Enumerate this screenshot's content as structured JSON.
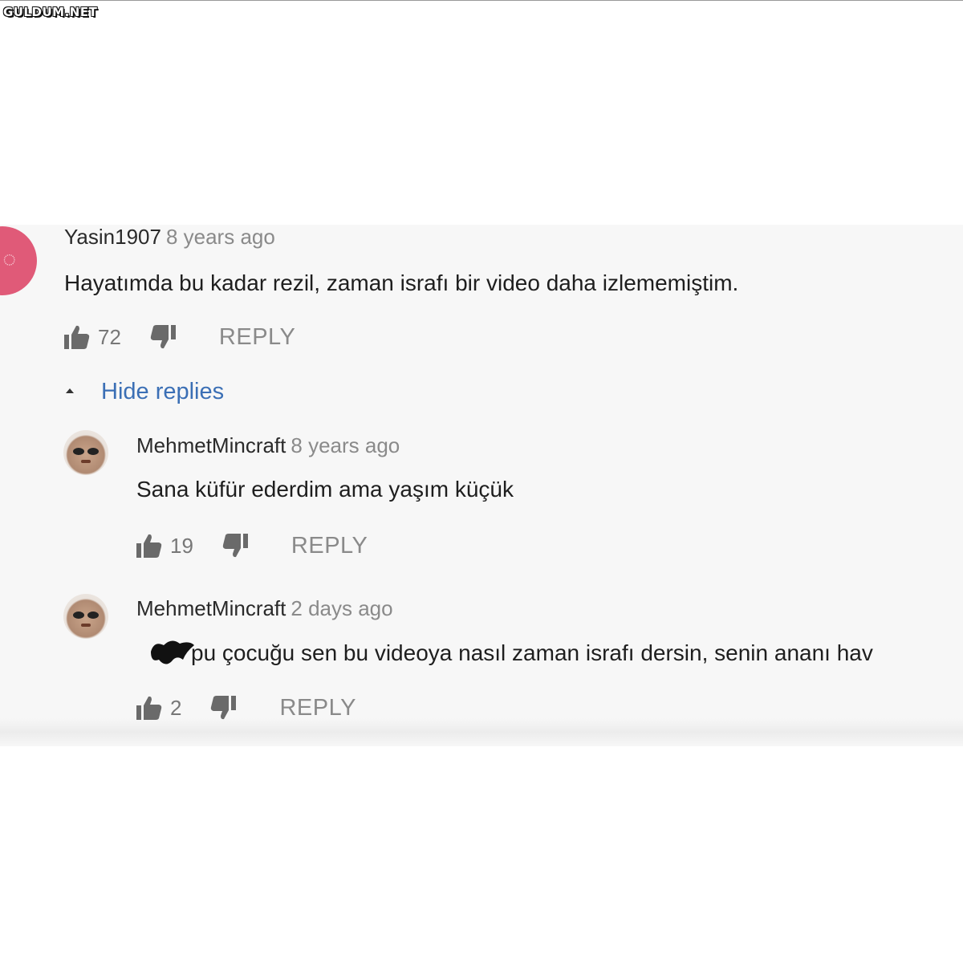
{
  "watermark": "GULDUM.NET",
  "comments": [
    {
      "author": "Yasin1907",
      "time": "8 years ago",
      "text": "Hayatımda bu kadar rezil, zaman israfı bir video daha izlememiştim.",
      "likes": "72",
      "reply_label": "REPLY",
      "avatar_icon": "default-letter-avatar",
      "avatar_color": "#e05a78"
    }
  ],
  "hide_replies_label": "Hide replies",
  "replies": [
    {
      "author": "MehmetMincraft",
      "time": "8 years ago",
      "text": "Sana küfür ederdim ama yaşım küçük",
      "likes": "19",
      "reply_label": "REPLY",
      "avatar_icon": "face-avatar"
    },
    {
      "author": "MehmetMincraft",
      "time": "2 days ago",
      "text_visible": "pu çocuğu sen bu videoya nasıl zaman israfı dersin, senin ananı hav",
      "likes": "2",
      "reply_label": "REPLY",
      "avatar_icon": "face-avatar"
    }
  ],
  "colors": {
    "link": "#3b6fb5",
    "meta": "#8a8a8a",
    "panel": "#f7f7f7"
  }
}
